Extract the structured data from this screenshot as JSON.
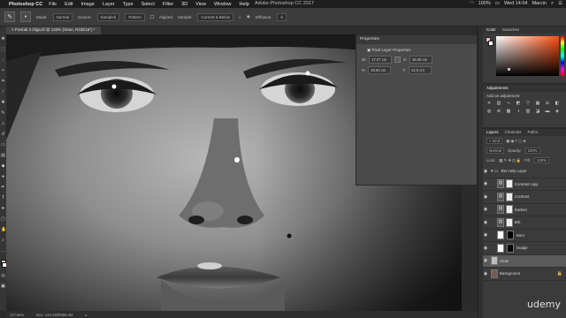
{
  "menubar": {
    "app": "Photoshop CC",
    "menus": [
      "File",
      "Edit",
      "Image",
      "Layer",
      "Type",
      "Select",
      "Filter",
      "3D",
      "View",
      "Window",
      "Help"
    ],
    "window_title": "Adobe Photoshop CC 2017",
    "zoom": "100%",
    "clock": "Wed 14:04",
    "user": "Marcin"
  },
  "options": {
    "mode_label": "Mode:",
    "mode_value": "Normal",
    "source_label": "Source:",
    "source_sampled": "Sampled",
    "source_pattern": "Pattern",
    "aligned_label": "Aligned",
    "sample_label": "Sample:",
    "sample_value": "Current & Below",
    "diffusion_label": "Diffusion:",
    "diffusion_value": "5"
  },
  "document": {
    "tab_title": "Portrait 3 Olga.tif @ 133% (clean, RGB/16*) *",
    "zoom_status": "117.94%",
    "doc_status": "Doc: 124.4M/5958.4M"
  },
  "properties": {
    "title": "Properties",
    "subtitle": "Pixel Layer Properties",
    "w_label": "W:",
    "w_value": "17.07 cm",
    "x_label": "X:",
    "x_value": "36.56 cm",
    "h_label": "H:",
    "h_value": "19.64 cm",
    "y_label": "Y:",
    "y_value": "14.9 cm"
  },
  "color_panel": {
    "tabs": [
      "Color",
      "Swatches"
    ],
    "fg_color": "#e7c2b6",
    "bg_color": "#ffffff"
  },
  "adjustments": {
    "tab": "Adjustments",
    "title": "Add an adjustment"
  },
  "layers_panel": {
    "tabs": [
      "Layers",
      "Channels",
      "Paths"
    ],
    "kind_label": "Kind",
    "blend_mode": "Normal",
    "opacity_label": "Opacity:",
    "opacity_value": "100%",
    "lock_label": "Lock:",
    "fill_label": "Fill:",
    "fill_value": "100%",
    "layers": [
      {
        "name": "BW Help Layer",
        "type": "group"
      },
      {
        "name": "Contrast copy",
        "type": "adjust"
      },
      {
        "name": "Contrast",
        "type": "adjust"
      },
      {
        "name": "Darken",
        "type": "adjust"
      },
      {
        "name": "Brit",
        "type": "adjust"
      },
      {
        "name": "Burn",
        "type": "layer"
      },
      {
        "name": "Dodge",
        "type": "layer"
      },
      {
        "name": "clean",
        "type": "pixel",
        "selected": true
      },
      {
        "name": "Background",
        "type": "pixel"
      }
    ]
  },
  "watermark": "udemy"
}
